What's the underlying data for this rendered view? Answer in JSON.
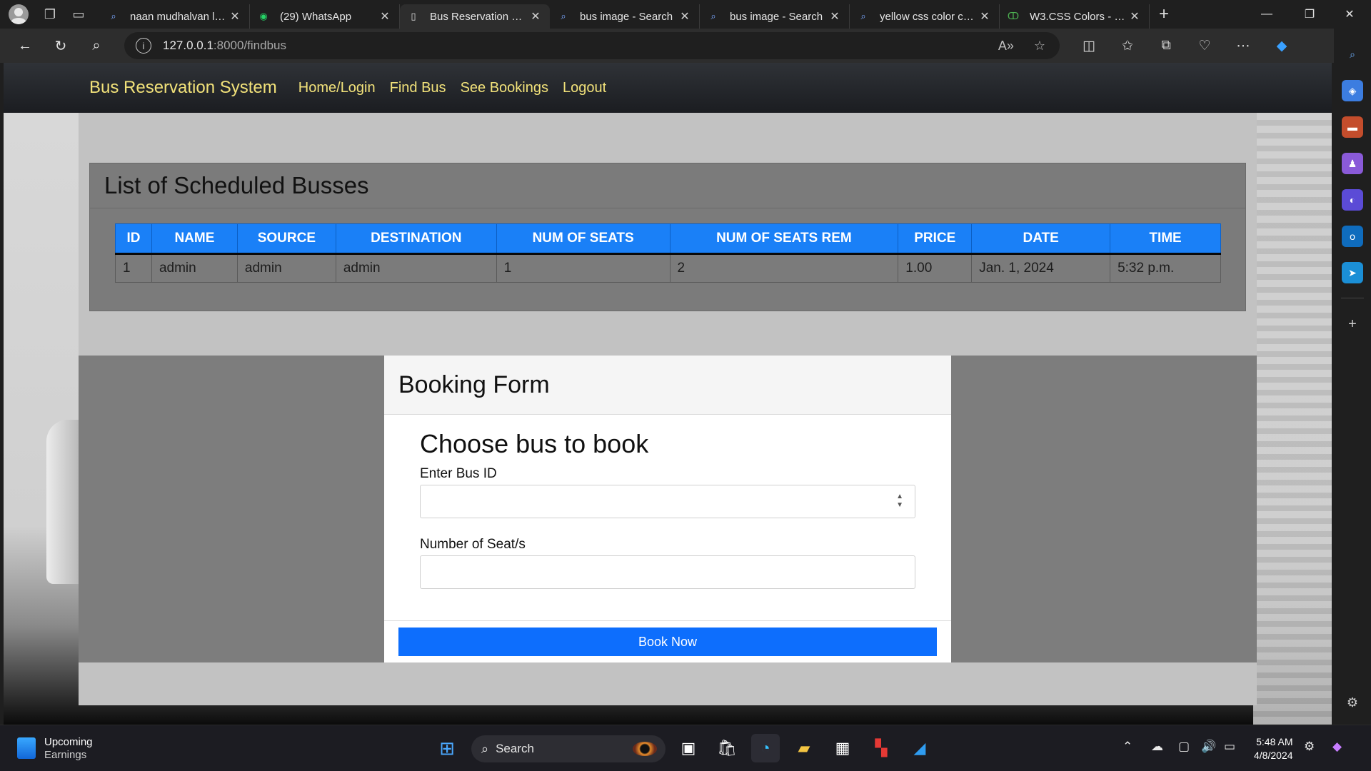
{
  "browser": {
    "tabs": [
      {
        "title": "naan mudhalvan login",
        "icon": "search-icon"
      },
      {
        "title": "(29) WhatsApp",
        "icon": "whatsapp-icon"
      },
      {
        "title": "Bus Reservation System",
        "icon": "page-icon",
        "active": true
      },
      {
        "title": "bus image - Search",
        "icon": "search-icon"
      },
      {
        "title": "bus image - Search",
        "icon": "search-icon"
      },
      {
        "title": "yellow css color code",
        "icon": "search-icon"
      },
      {
        "title": "W3.CSS Colors - Ge",
        "icon": "w3schools-icon"
      }
    ],
    "url_host": "127.0.0.1",
    "url_path": ":8000/findbus"
  },
  "nav": {
    "brand": "Bus Reservation System",
    "links": [
      "Home/Login",
      "Find Bus",
      "See Bookings",
      "Logout"
    ],
    "color": "#f2e27a"
  },
  "schedule": {
    "title": "List of Scheduled Busses",
    "columns": [
      "ID",
      "NAME",
      "SOURCE",
      "DESTINATION",
      "NUM OF SEATS",
      "NUM OF SEATS REM",
      "PRICE",
      "DATE",
      "TIME"
    ],
    "rows": [
      [
        "1",
        "admin",
        "admin",
        "admin",
        "1",
        "2",
        "1.00",
        "Jan. 1, 2024",
        "5:32 p.m."
      ]
    ],
    "header_color": "#1a80f7"
  },
  "booking": {
    "header": "Booking Form",
    "heading": "Choose bus to book",
    "bus_id_label": "Enter Bus ID",
    "bus_id_value": "",
    "seats_label": "Number of Seat/s",
    "seats_value": "",
    "submit_label": "Book Now",
    "button_color": "#0d6efd"
  },
  "taskbar": {
    "weather_title": "Upcoming",
    "weather_sub": "Earnings",
    "search_label": "Search",
    "time": "5:48 AM",
    "date": "4/8/2024"
  }
}
